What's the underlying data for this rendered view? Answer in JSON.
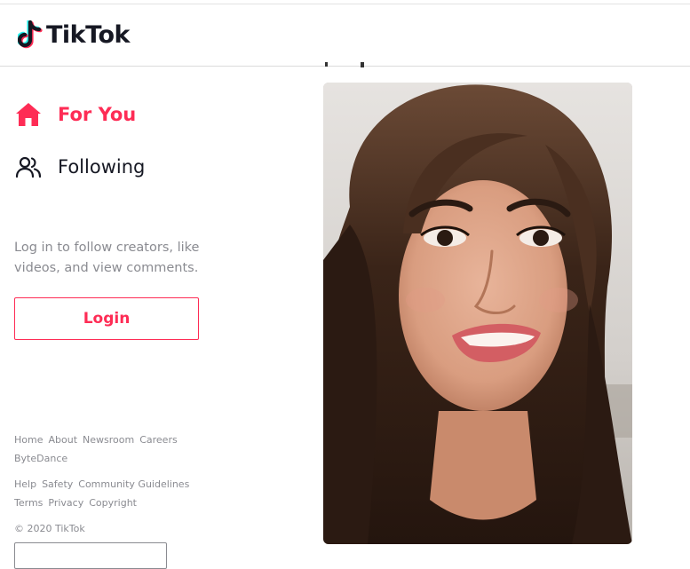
{
  "app": {
    "name": "TikTok",
    "brand_color": "#fe2c55",
    "logo_icon": "tiktok-note-icon"
  },
  "nav": {
    "items": [
      {
        "label": "For You",
        "icon": "home-icon",
        "active": true
      },
      {
        "label": "Following",
        "icon": "people-icon",
        "active": false
      }
    ]
  },
  "login": {
    "prompt": "Log in to follow creators, like videos, and view comments.",
    "button_label": "Login"
  },
  "footer": {
    "group1": [
      "Home",
      "About",
      "Newsroom",
      "Careers",
      "ByteDance"
    ],
    "group2": [
      "Help",
      "Safety",
      "Community Guidelines",
      "Terms",
      "Privacy",
      "Copyright"
    ],
    "copyright": "© 2020 TikTok"
  },
  "feed": {
    "video_content": "woman-smiling-selfie-video"
  }
}
